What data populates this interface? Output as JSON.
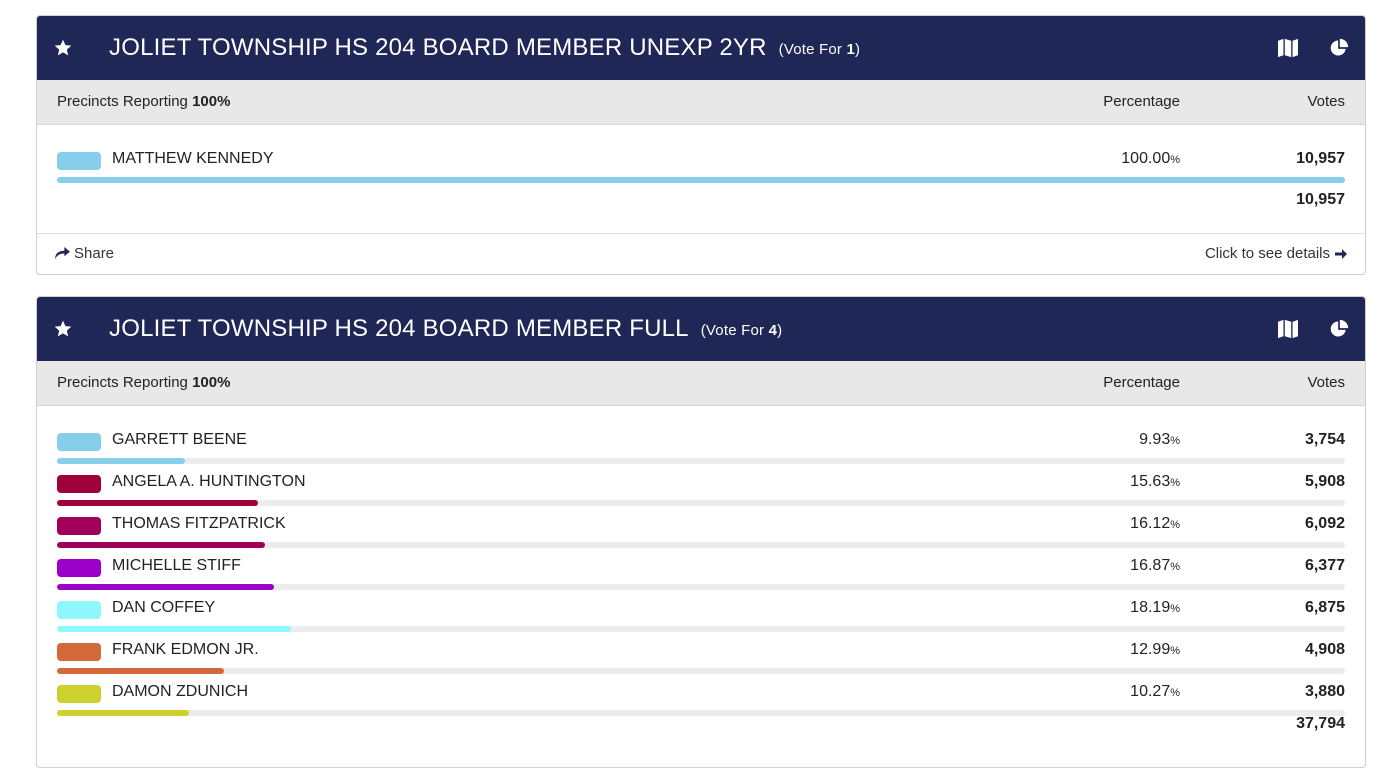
{
  "races": [
    {
      "title": "JOLIET TOWNSHIP HS 204 BOARD MEMBER UNEXP 2YR",
      "vote_for_prefix": "(Vote For ",
      "vote_for_count": "1",
      "vote_for_suffix": ")",
      "reporting_label": "Precincts Reporting",
      "reporting_value": "100%",
      "percentage_header": "Percentage",
      "votes_header": "Votes",
      "candidates": [
        {
          "name": "MATTHEW KENNEDY",
          "pct": "100.00",
          "pct_symbol": "%",
          "votes": "10,957",
          "share": 1.0,
          "color": "#87ceeb"
        }
      ],
      "total_votes": "10,957",
      "share_label": "Share",
      "details_label": "Click to see details"
    },
    {
      "title": "JOLIET TOWNSHIP HS 204 BOARD MEMBER FULL",
      "vote_for_prefix": "(Vote For ",
      "vote_for_count": "4",
      "vote_for_suffix": ")",
      "reporting_label": "Precincts Reporting",
      "reporting_value": "100%",
      "percentage_header": "Percentage",
      "votes_header": "Votes",
      "candidates": [
        {
          "name": "GARRETT BEENE",
          "pct": "9.93",
          "pct_symbol": "%",
          "votes": "3,754",
          "share": 0.0993,
          "color": "#87ceeb"
        },
        {
          "name": "ANGELA A. HUNTINGTON",
          "pct": "15.63",
          "pct_symbol": "%",
          "votes": "5,908",
          "share": 0.1563,
          "color": "#a0003a"
        },
        {
          "name": "THOMAS FITZPATRICK",
          "pct": "16.12",
          "pct_symbol": "%",
          "votes": "6,092",
          "share": 0.1612,
          "color": "#a0005a"
        },
        {
          "name": "MICHELLE STIFF",
          "pct": "16.87",
          "pct_symbol": "%",
          "votes": "6,377",
          "share": 0.1687,
          "color": "#9b00c8"
        },
        {
          "name": "DAN COFFEY",
          "pct": "18.19",
          "pct_symbol": "%",
          "votes": "6,875",
          "share": 0.1819,
          "color": "#8ff8ff"
        },
        {
          "name": "FRANK EDMON JR.",
          "pct": "12.99",
          "pct_symbol": "%",
          "votes": "4,908",
          "share": 0.1299,
          "color": "#d4683a"
        },
        {
          "name": "DAMON ZDUNICH",
          "pct": "10.27",
          "pct_symbol": "%",
          "votes": "3,880",
          "share": 0.1027,
          "color": "#cdd12e"
        }
      ],
      "total_votes": "37,794"
    }
  ],
  "icons": {
    "star": "star-icon",
    "map": "map-icon",
    "pie": "pie-chart-icon",
    "share": "share-icon",
    "arrow": "arrow-right-icon"
  },
  "colors": {
    "header_bg": "#1f2757",
    "subheader_bg": "#e8e8e8"
  }
}
